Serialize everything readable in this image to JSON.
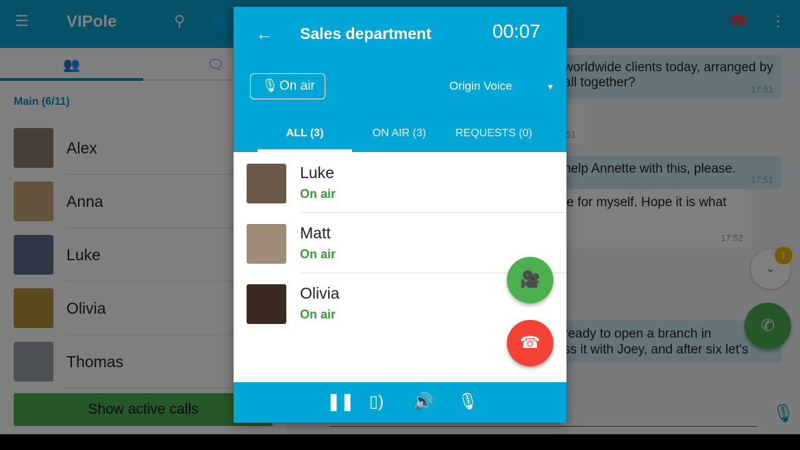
{
  "app": {
    "title": "VIPole",
    "badge": "1"
  },
  "sidebar": {
    "group": "Main (6/11)",
    "contacts": [
      {
        "name": "Alex",
        "color": "#8a7e6a"
      },
      {
        "name": "Anna",
        "color": "#c9a77a"
      },
      {
        "name": "Luke",
        "color": "#5a6f8a"
      },
      {
        "name": "Olivia",
        "color": "#b8903a"
      },
      {
        "name": "Thomas",
        "color": "#9aa4ae"
      }
    ],
    "show_calls": "Show active calls"
  },
  "chat": {
    "messages": [
      {
        "text": "worldwide clients today, arranged by\nall together?",
        "time": "17:51"
      },
      {
        "text": "",
        "time": "51"
      },
      {
        "text": "help Annette with this, please.",
        "time": "17:51"
      },
      {
        "text": "le for myself. Hope it is what",
        "time": "17:52"
      },
      {
        "text": "ready to open a branch in\nss it with Joey, and after six let's",
        "time": ""
      }
    ],
    "unread": "1"
  },
  "dialog": {
    "title": "Sales department",
    "timer": "00:07",
    "on_air": "On air",
    "voice": "Origin Voice",
    "tabs": [
      "ALL (3)",
      "ON AIR (3)",
      "REQUESTS (0)"
    ],
    "participants": [
      {
        "name": "Luke",
        "status": "On air",
        "color": "#6b5a4a"
      },
      {
        "name": "Matt",
        "status": "On air",
        "color": "#a08a78"
      },
      {
        "name": "Olivia",
        "status": "On air",
        "color": "#3a2a20"
      }
    ]
  },
  "colors": {
    "accent": "#00a6d6",
    "green": "#4caf50",
    "red": "#f44336",
    "status": "#3a9b3a"
  }
}
